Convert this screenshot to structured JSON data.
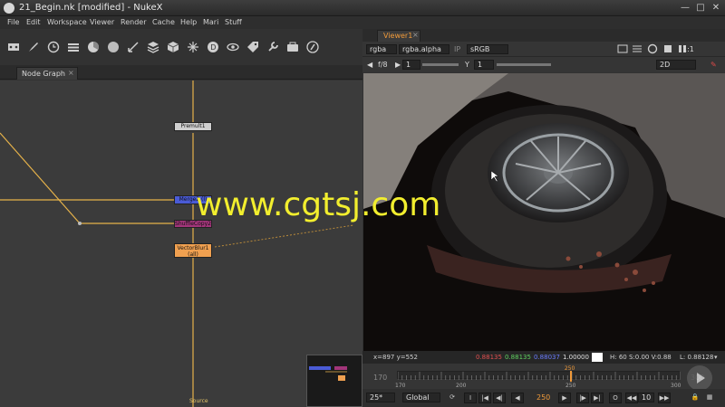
{
  "window": {
    "title": "21_Begin.nk [modified] - NukeX",
    "controls": [
      "✕",
      "□",
      "—"
    ]
  },
  "menu": [
    "File",
    "Edit",
    "Workspace",
    "Viewer",
    "Render",
    "Cache",
    "Help",
    "Mari",
    "Stuff"
  ],
  "node_graph": {
    "tab_label": "Node Graph",
    "tab_close": "×",
    "nodes": {
      "premult": "Premult1",
      "merge": "Merge2 (l)",
      "shuffle": "ShuffleCopy2",
      "vectorblur": "VectorBlur1",
      "vectorblur_sub": "(all)",
      "source": "Source"
    }
  },
  "viewer": {
    "tab_label": "Viewer1",
    "tab_close": "×",
    "channels": "rgba",
    "layer": "rgba.alpha",
    "ip_label": "IP",
    "lut": "sRGB",
    "zoom": "1:1",
    "fstop": "f/8",
    "gain": "1",
    "y_label": "Y",
    "gamma": "1",
    "view_mode": "2D",
    "status": {
      "coords": "x=897 y=552",
      "r": "0.88135",
      "g": "0.88135",
      "b": "0.88037",
      "a": "1.00000",
      "hsv": "H: 60 S:0.00 V:0.88",
      "luma": "L: 0.88128"
    },
    "colors": {
      "accent": "#f09a3a",
      "r": "#e05050",
      "g": "#60d060",
      "b": "#6a7cff"
    }
  },
  "timeline": {
    "start": "170",
    "end": "300",
    "ticks": [
      "170",
      "200",
      "250",
      "300"
    ],
    "current": "250",
    "current_fraction": 0.615,
    "fps": "25*",
    "range_mode": "Global",
    "step": "10",
    "increment_label": "+"
  },
  "watermark": "www.cgtsj.com"
}
